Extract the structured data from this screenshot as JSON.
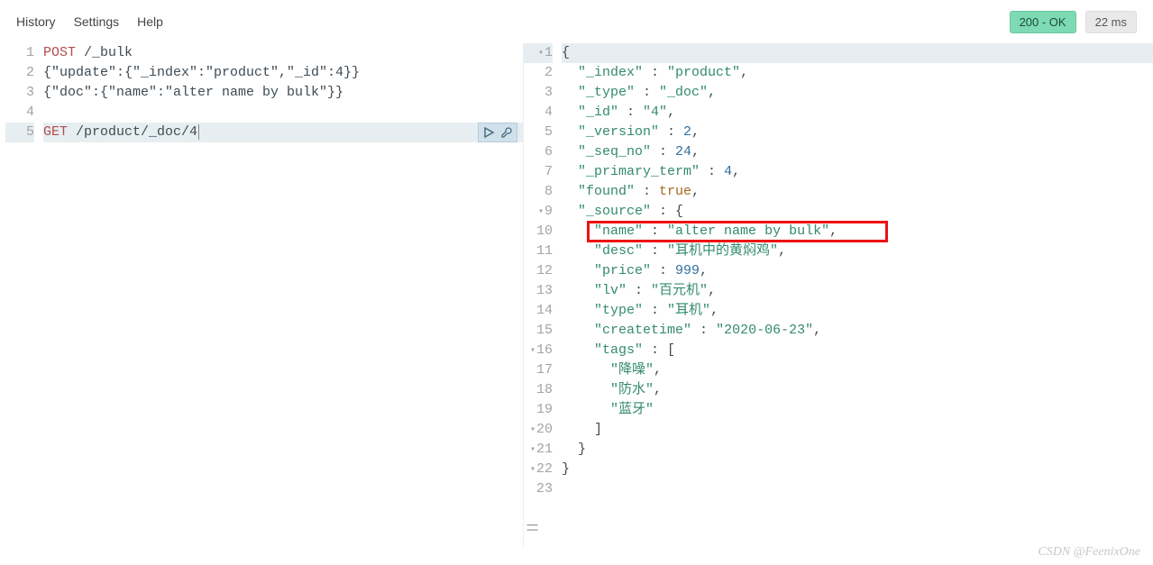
{
  "menu": {
    "history": "History",
    "settings": "Settings",
    "help": "Help"
  },
  "status": {
    "code": "200 - OK",
    "time": "22 ms"
  },
  "editor": {
    "lines": [
      {
        "n": 1,
        "method": "POST",
        "rest": " /_bulk"
      },
      {
        "n": 2,
        "raw": "{\"update\":{\"_index\":\"product\",\"_id\":4}}"
      },
      {
        "n": 3,
        "raw": "{\"doc\":{\"name\":\"alter name by bulk\"}}"
      },
      {
        "n": 4,
        "raw": ""
      },
      {
        "n": 5,
        "method": "GET",
        "rest": " /product/_doc/4",
        "active": true
      }
    ]
  },
  "response": {
    "lines": [
      {
        "n": 1,
        "indent": 0,
        "txt": "{",
        "fold": true
      },
      {
        "n": 2,
        "indent": 1,
        "key": "_index",
        "val": "product",
        "type": "str",
        "comma": true
      },
      {
        "n": 3,
        "indent": 1,
        "key": "_type",
        "val": "_doc",
        "type": "str",
        "comma": true
      },
      {
        "n": 4,
        "indent": 1,
        "key": "_id",
        "val": "4",
        "type": "str",
        "comma": true
      },
      {
        "n": 5,
        "indent": 1,
        "key": "_version",
        "val": "2",
        "type": "num",
        "comma": true
      },
      {
        "n": 6,
        "indent": 1,
        "key": "_seq_no",
        "val": "24",
        "type": "num",
        "comma": true
      },
      {
        "n": 7,
        "indent": 1,
        "key": "_primary_term",
        "val": "4",
        "type": "num",
        "comma": true
      },
      {
        "n": 8,
        "indent": 1,
        "key": "found",
        "val": "true",
        "type": "bool",
        "comma": true
      },
      {
        "n": 9,
        "indent": 1,
        "key": "_source",
        "open": "{",
        "fold": true
      },
      {
        "n": 10,
        "indent": 2,
        "key": "name",
        "val": "alter name by bulk",
        "type": "str",
        "comma": true,
        "highlight": true
      },
      {
        "n": 11,
        "indent": 2,
        "key": "desc",
        "val": "耳机中的黄焖鸡",
        "type": "str",
        "comma": true
      },
      {
        "n": 12,
        "indent": 2,
        "key": "price",
        "val": "999",
        "type": "num",
        "comma": true
      },
      {
        "n": 13,
        "indent": 2,
        "key": "lv",
        "val": "百元机",
        "type": "str",
        "comma": true
      },
      {
        "n": 14,
        "indent": 2,
        "key": "type",
        "val": "耳机",
        "type": "str",
        "comma": true
      },
      {
        "n": 15,
        "indent": 2,
        "key": "createtime",
        "val": "2020-06-23",
        "type": "str",
        "comma": true
      },
      {
        "n": 16,
        "indent": 2,
        "key": "tags",
        "open": "[",
        "fold": true
      },
      {
        "n": 17,
        "indent": 3,
        "arr": "降噪",
        "comma": true
      },
      {
        "n": 18,
        "indent": 3,
        "arr": "防水",
        "comma": true
      },
      {
        "n": 19,
        "indent": 3,
        "arr": "蓝牙"
      },
      {
        "n": 20,
        "indent": 2,
        "close": "]",
        "fold": true
      },
      {
        "n": 21,
        "indent": 1,
        "close": "}",
        "fold": true
      },
      {
        "n": 22,
        "indent": 0,
        "close": "}",
        "fold": true
      },
      {
        "n": 23,
        "indent": 0,
        "txt": ""
      }
    ]
  },
  "watermark": "CSDN @FeenixOne"
}
